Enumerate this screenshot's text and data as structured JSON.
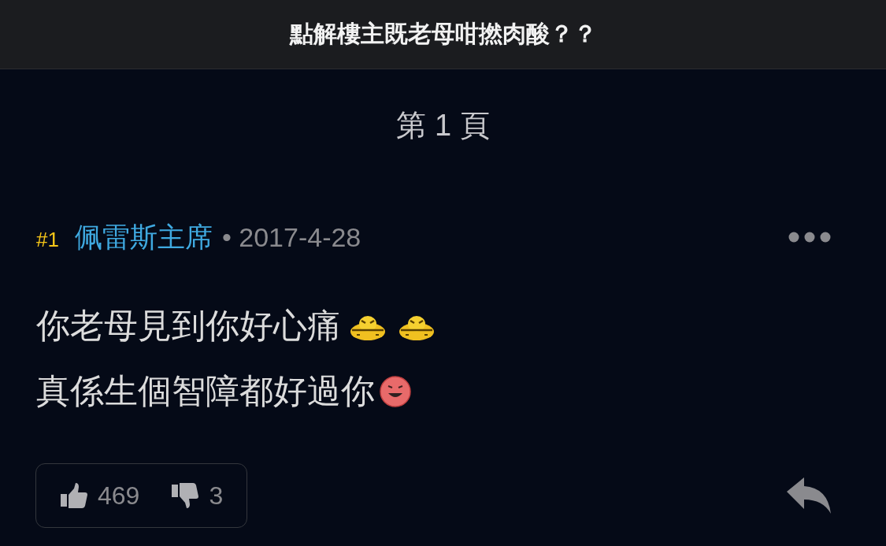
{
  "header": {
    "title": "點解樓主既老母咁撚肉酸？？"
  },
  "page_label": "第 1 頁",
  "post": {
    "number": "#1",
    "author": "佩雷斯主席",
    "date": "• 2017-4-28",
    "lines": [
      "你老母見到你好心痛",
      "真係生個智障都好過你"
    ],
    "likes": "469",
    "dislikes": "3"
  }
}
